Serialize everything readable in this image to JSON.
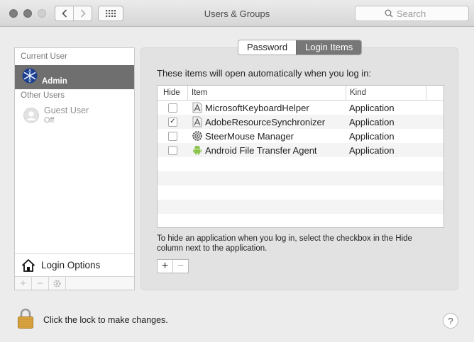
{
  "window": {
    "title": "Users & Groups"
  },
  "toolbar": {
    "search_placeholder": "Search"
  },
  "sidebar": {
    "current_user_label": "Current User",
    "current_user": {
      "name": "Admin"
    },
    "other_users_label": "Other Users",
    "other_users": [
      {
        "name": "Guest User",
        "status": "Off"
      }
    ],
    "login_options_label": "Login Options"
  },
  "tabs": [
    {
      "label": "Password",
      "active": false
    },
    {
      "label": "Login Items",
      "active": true
    }
  ],
  "login_items": {
    "intro": "These items will open automatically when you log in:",
    "columns": {
      "hide": "Hide",
      "item": "Item",
      "kind": "Kind"
    },
    "rows": [
      {
        "hide": false,
        "item": "MicrosoftKeyboardHelper",
        "kind": "Application",
        "icon": "app-generic-icon"
      },
      {
        "hide": true,
        "item": "AdobeResourceSynchronizer",
        "kind": "Application",
        "icon": "app-generic-icon"
      },
      {
        "hide": false,
        "item": "SteerMouse Manager",
        "kind": "Application",
        "icon": "gear-app-icon"
      },
      {
        "hide": false,
        "item": "Android File Transfer Agent",
        "kind": "Application",
        "icon": "android-icon"
      }
    ],
    "hint": "To hide an application when you log in, select the checkbox in the Hide column next to the application."
  },
  "footer": {
    "lock_text": "Click the lock to make changes."
  }
}
